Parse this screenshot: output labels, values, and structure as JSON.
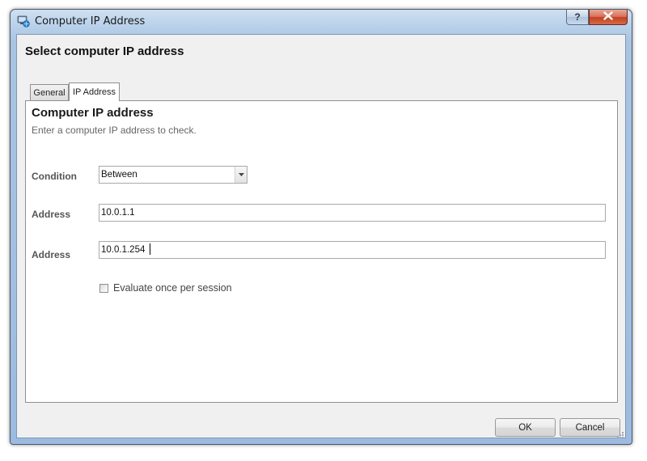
{
  "window": {
    "title": "Computer IP Address",
    "help_label": "?",
    "close_icon": "close-icon"
  },
  "dialog": {
    "heading": "Select computer IP address"
  },
  "tabs": [
    {
      "label": "General",
      "active": false
    },
    {
      "label": "IP Address",
      "active": true
    }
  ],
  "panel": {
    "title": "Computer IP address",
    "description": "Enter a computer IP address to check."
  },
  "form": {
    "condition_label": "Condition",
    "condition_value": "Between",
    "address1_label": "Address",
    "address1_value": "10.0.1.1",
    "address2_label": "Address",
    "address2_value": "10.0.1.254",
    "evaluate_label": "Evaluate once per session",
    "evaluate_checked": false
  },
  "buttons": {
    "ok": "OK",
    "cancel": "Cancel"
  },
  "colors": {
    "window_frame": "#a9c4e2",
    "close_button": "#c1401f",
    "panel_background": "#ffffff",
    "dialog_background": "#f0f0f0"
  }
}
